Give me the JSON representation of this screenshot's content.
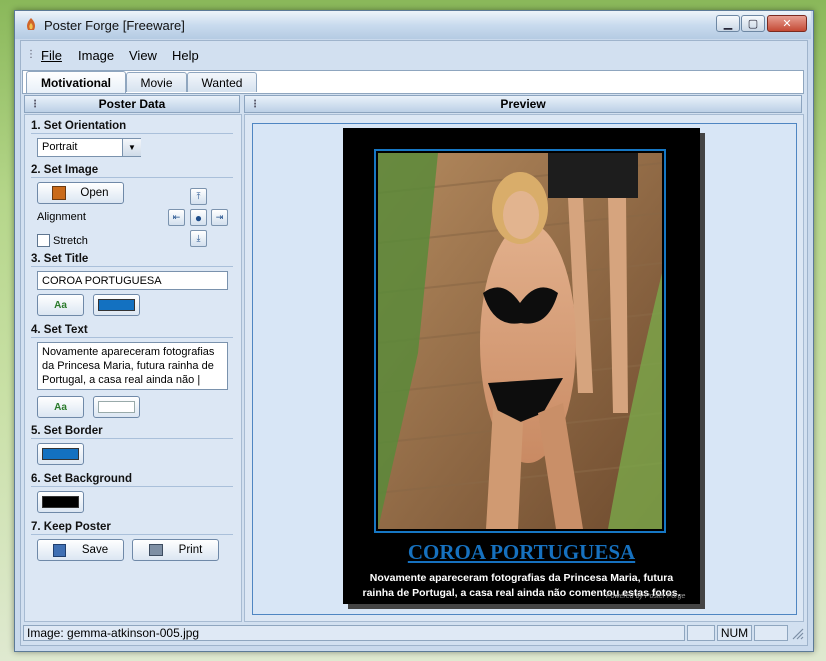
{
  "window": {
    "title": "Poster Forge [Freeware]"
  },
  "menu": [
    "File",
    "Image",
    "View",
    "Help"
  ],
  "tabs": [
    "Motivational",
    "Movie",
    "Wanted"
  ],
  "left_panel": {
    "header": "Poster Data",
    "sections": {
      "orientation": "1. Set Orientation",
      "image": "2. Set Image",
      "title": "3. Set Title",
      "text": "4. Set Text",
      "border": "5. Set Border",
      "background": "6. Set Background",
      "keep": "7. Keep Poster"
    },
    "orientation_value": "Portrait",
    "open_label": "Open",
    "alignment_label": "Alignment",
    "stretch_label": "Stretch",
    "title_value": "COROA PORTUGUESA",
    "font_glyph": "Aa",
    "text_value": "Novamente apareceram fotografias da Princesa Maria, futura rainha de Portugal, a casa real ainda não |",
    "save_label": "Save",
    "print_label": "Print"
  },
  "colors": {
    "title_color": "#1371c1",
    "text_color": "#ffffff",
    "border_color": "#1371c1",
    "background_color": "#000000"
  },
  "preview": {
    "header": "Preview",
    "poster_title": "COROA PORTUGUESA",
    "poster_text": "Novamente apareceram fotografias da Princesa Maria, futura rainha de Portugal, a casa real ainda não comentou estas fotos.",
    "watermark": "Powered by Poster Forge"
  },
  "status": {
    "image_file": "Image: gemma-atkinson-005.jpg",
    "num": "NUM"
  }
}
